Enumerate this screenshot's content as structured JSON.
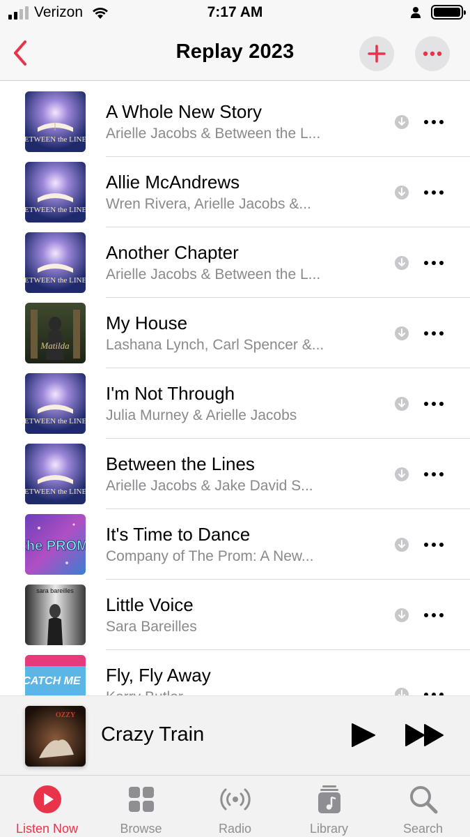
{
  "status_bar": {
    "carrier": "Verizon",
    "time": "7:17 AM"
  },
  "header": {
    "title": "Replay 2023",
    "back_icon": "chevron-left-icon",
    "add_icon": "plus-icon",
    "more_icon": "ellipsis-icon"
  },
  "colors": {
    "accent": "#e8334a",
    "secondary_text": "#8a8a8e",
    "icon_gray": "#c7c7cc"
  },
  "songs": [
    {
      "title": "A Whole New Story",
      "artist": "Arielle Jacobs & Between the L...",
      "art": "between-the-lines"
    },
    {
      "title": "Allie McAndrews",
      "artist": "Wren Rivera, Arielle Jacobs &...",
      "art": "between-the-lines"
    },
    {
      "title": "Another Chapter",
      "artist": "Arielle Jacobs & Between the L...",
      "art": "between-the-lines"
    },
    {
      "title": "My House",
      "artist": "Lashana Lynch, Carl Spencer &...",
      "art": "matilda"
    },
    {
      "title": "I'm Not Through",
      "artist": "Julia Murney & Arielle Jacobs",
      "art": "between-the-lines"
    },
    {
      "title": "Between the Lines",
      "artist": "Arielle Jacobs & Jake David S...",
      "art": "between-the-lines"
    },
    {
      "title": "It's Time to Dance",
      "artist": "Company of The Prom: A New...",
      "art": "the-prom"
    },
    {
      "title": "Little Voice",
      "artist": "Sara Bareilles",
      "art": "sara-bareilles"
    },
    {
      "title": "Fly, Fly Away",
      "artist": "Kerry Butler",
      "art": "catch-me-if-you-can"
    }
  ],
  "album_art_text": {
    "between_the_lines": "BETWEEN the LINES",
    "the_prom": "the PROM",
    "catch_me": "CATCH ME",
    "sara_bareilles": "sara bareilles"
  },
  "now_playing": {
    "title": "Crazy Train",
    "play_icon": "play-icon",
    "forward_icon": "fast-forward-icon"
  },
  "tabs": [
    {
      "label": "Listen Now",
      "icon": "play-circle-icon",
      "active": true
    },
    {
      "label": "Browse",
      "icon": "grid-icon",
      "active": false
    },
    {
      "label": "Radio",
      "icon": "radio-waves-icon",
      "active": false
    },
    {
      "label": "Library",
      "icon": "music-library-icon",
      "active": false
    },
    {
      "label": "Search",
      "icon": "search-icon",
      "active": false
    }
  ]
}
